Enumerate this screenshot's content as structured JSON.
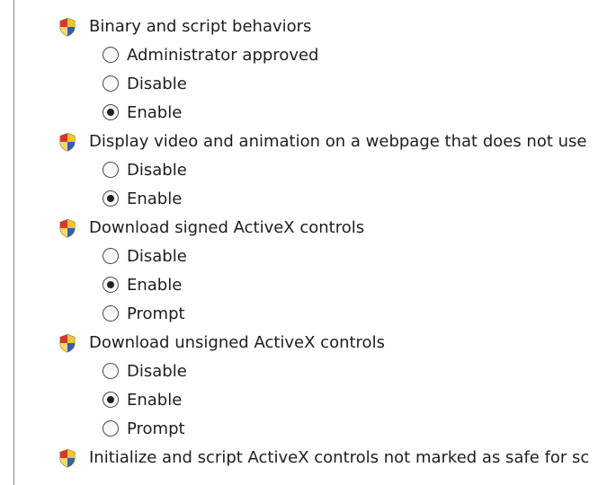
{
  "settings": [
    {
      "label": "Binary and script behaviors",
      "icon": "security-shield-icon",
      "options": [
        {
          "label": "Administrator approved",
          "checked": false
        },
        {
          "label": "Disable",
          "checked": false
        },
        {
          "label": "Enable",
          "checked": true
        }
      ]
    },
    {
      "label": "Display video and animation on a webpage that does not use",
      "icon": "security-shield-icon",
      "options": [
        {
          "label": "Disable",
          "checked": false
        },
        {
          "label": "Enable",
          "checked": true
        }
      ]
    },
    {
      "label": "Download signed ActiveX controls",
      "icon": "security-shield-icon",
      "options": [
        {
          "label": "Disable",
          "checked": false
        },
        {
          "label": "Enable",
          "checked": true
        },
        {
          "label": "Prompt",
          "checked": false
        }
      ]
    },
    {
      "label": "Download unsigned ActiveX controls",
      "icon": "security-shield-icon",
      "options": [
        {
          "label": "Disable",
          "checked": false
        },
        {
          "label": "Enable",
          "checked": true
        },
        {
          "label": "Prompt",
          "checked": false
        }
      ]
    },
    {
      "label": "Initialize and script ActiveX controls not marked as safe for sc",
      "icon": "security-shield-icon",
      "options": []
    }
  ],
  "colors": {
    "text": "#1e1e1e",
    "frame_border": "#8e8f8f",
    "shield_red": "#d23b2a",
    "shield_yellow": "#f4c430",
    "shield_blue": "#2f5fb8"
  }
}
